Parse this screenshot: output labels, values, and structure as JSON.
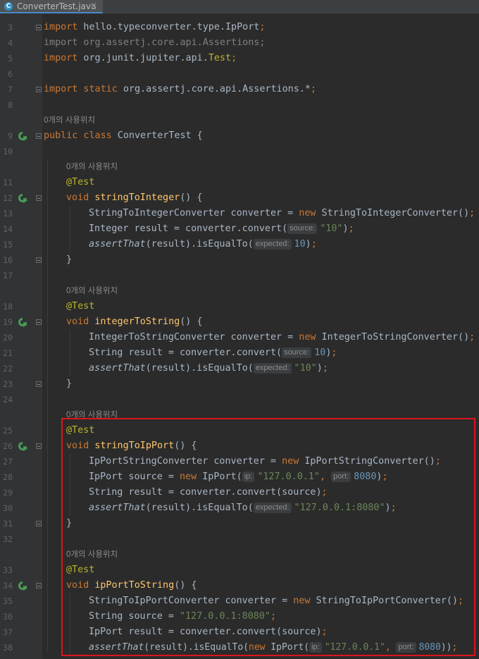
{
  "tab": {
    "icon_letter": "C",
    "filename": "ConverterTest.java",
    "close": "✕"
  },
  "hint_usage": "0개의 사용위치",
  "params": {
    "source": "source:",
    "expected": "expected:",
    "ip": "ip:",
    "port": "port:"
  },
  "lines": {
    "l3": {
      "num": "3",
      "kw": "import",
      "pkg": " hello.typeconverter.type.IpPort",
      "semi": ";"
    },
    "l4": {
      "num": "4",
      "kw": "import",
      "pkg": " org.assertj.core.api.Assertions",
      "semi": ";"
    },
    "l5": {
      "num": "5",
      "kw": "import",
      "pkg": " org.junit.jupiter.api.",
      "cls": "Test",
      "semi": ";"
    },
    "l6": {
      "num": "6"
    },
    "l7": {
      "num": "7",
      "kw": "import static",
      "pkg": " org.assertj.core.api.Assertions.*",
      "semi": ";"
    },
    "l8": {
      "num": "8"
    },
    "l9": {
      "num": "9",
      "kw": "public class",
      "rest": " ConverterTest {"
    },
    "l10": {
      "num": "10"
    },
    "l11": {
      "num": "11",
      "ann": "@Test"
    },
    "l12": {
      "num": "12",
      "kw": "void",
      "fn": "stringToInteger",
      "rest": "() {"
    },
    "l13": {
      "num": "13",
      "a": "StringToIntegerConverter converter = ",
      "kw": "new",
      "b": " StringToIntegerConverter()",
      "semi": ";"
    },
    "l14": {
      "num": "14",
      "a": "Integer result = converter.convert(",
      "str": "\"10\"",
      "b": ")",
      "semi": ";"
    },
    "l15": {
      "num": "15",
      "it": "assertThat",
      "a": "(result).isEqualTo(",
      "num2": "10",
      "b": ")",
      "semi": ";"
    },
    "l16": {
      "num": "16",
      "rest": "}"
    },
    "l17": {
      "num": "17"
    },
    "l18": {
      "num": "18",
      "ann": "@Test"
    },
    "l19": {
      "num": "19",
      "kw": "void",
      "fn": "integerToString",
      "rest": "() {"
    },
    "l20": {
      "num": "20",
      "a": "IntegerToStringConverter converter = ",
      "kw": "new",
      "b": " IntegerToStringConverter()",
      "semi": ";"
    },
    "l21": {
      "num": "21",
      "a": "String result = converter.convert(",
      "num2": "10",
      "b": ")",
      "semi": ";"
    },
    "l22": {
      "num": "22",
      "it": "assertThat",
      "a": "(result).isEqualTo(",
      "str": "\"10\"",
      "b": ")",
      "semi": ";"
    },
    "l23": {
      "num": "23",
      "rest": "}"
    },
    "l24": {
      "num": "24"
    },
    "l25": {
      "num": "25",
      "ann": "@Test"
    },
    "l26": {
      "num": "26",
      "kw": "void",
      "fn": "stringToIpPort",
      "rest": "() {"
    },
    "l27": {
      "num": "27",
      "a": "IpPortStringConverter converter = ",
      "kw": "new",
      "b": " IpPortStringConverter()",
      "semi": ";"
    },
    "l28": {
      "num": "28",
      "a": "IpPort source = ",
      "kw": "new",
      "b": " IpPort(",
      "str": "\"127.0.0.1\"",
      "comma": ", ",
      "num2": "8080",
      "c": ")",
      "semi": ";"
    },
    "l29": {
      "num": "29",
      "a": "String result = converter.convert(source)",
      "semi": ";"
    },
    "l30": {
      "num": "30",
      "it": "assertThat",
      "a": "(result).isEqualTo(",
      "str": "\"127.0.0.1:8080\"",
      "b": ")",
      "semi": ";"
    },
    "l31": {
      "num": "31",
      "rest": "}"
    },
    "l32": {
      "num": "32"
    },
    "l33": {
      "num": "33",
      "ann": "@Test"
    },
    "l34": {
      "num": "34",
      "kw": "void",
      "fn": "ipPortToString",
      "rest": "() {"
    },
    "l35": {
      "num": "35",
      "a": "StringToIpPortConverter converter = ",
      "kw": "new",
      "b": " StringToIpPortConverter()",
      "semi": ";"
    },
    "l36": {
      "num": "36",
      "a": "String source = ",
      "str": "\"127.0.0.1:8080\"",
      "semi": ";"
    },
    "l37": {
      "num": "37",
      "a": "IpPort result = converter.convert(source)",
      "semi": ";"
    },
    "l38": {
      "num": "38",
      "it": "assertThat",
      "a": "(result).isEqualTo(",
      "kw": "new",
      "b": " IpPort(",
      "str": "\"127.0.0.1\"",
      "comma": ", ",
      "num2": "8080",
      "c": "))",
      "semi": ";"
    }
  },
  "colors": {
    "background": "#2b2b2b",
    "keyword": "#cc7832",
    "annotation": "#bbb529",
    "function": "#ffc66d",
    "string": "#6a8759",
    "number": "#6897bb",
    "highlight_box": "#e0141c",
    "run_icon": "#499c54"
  },
  "icons": {
    "run": "run-test-icon",
    "fold": "fold-icon",
    "file": "java-class-icon"
  }
}
